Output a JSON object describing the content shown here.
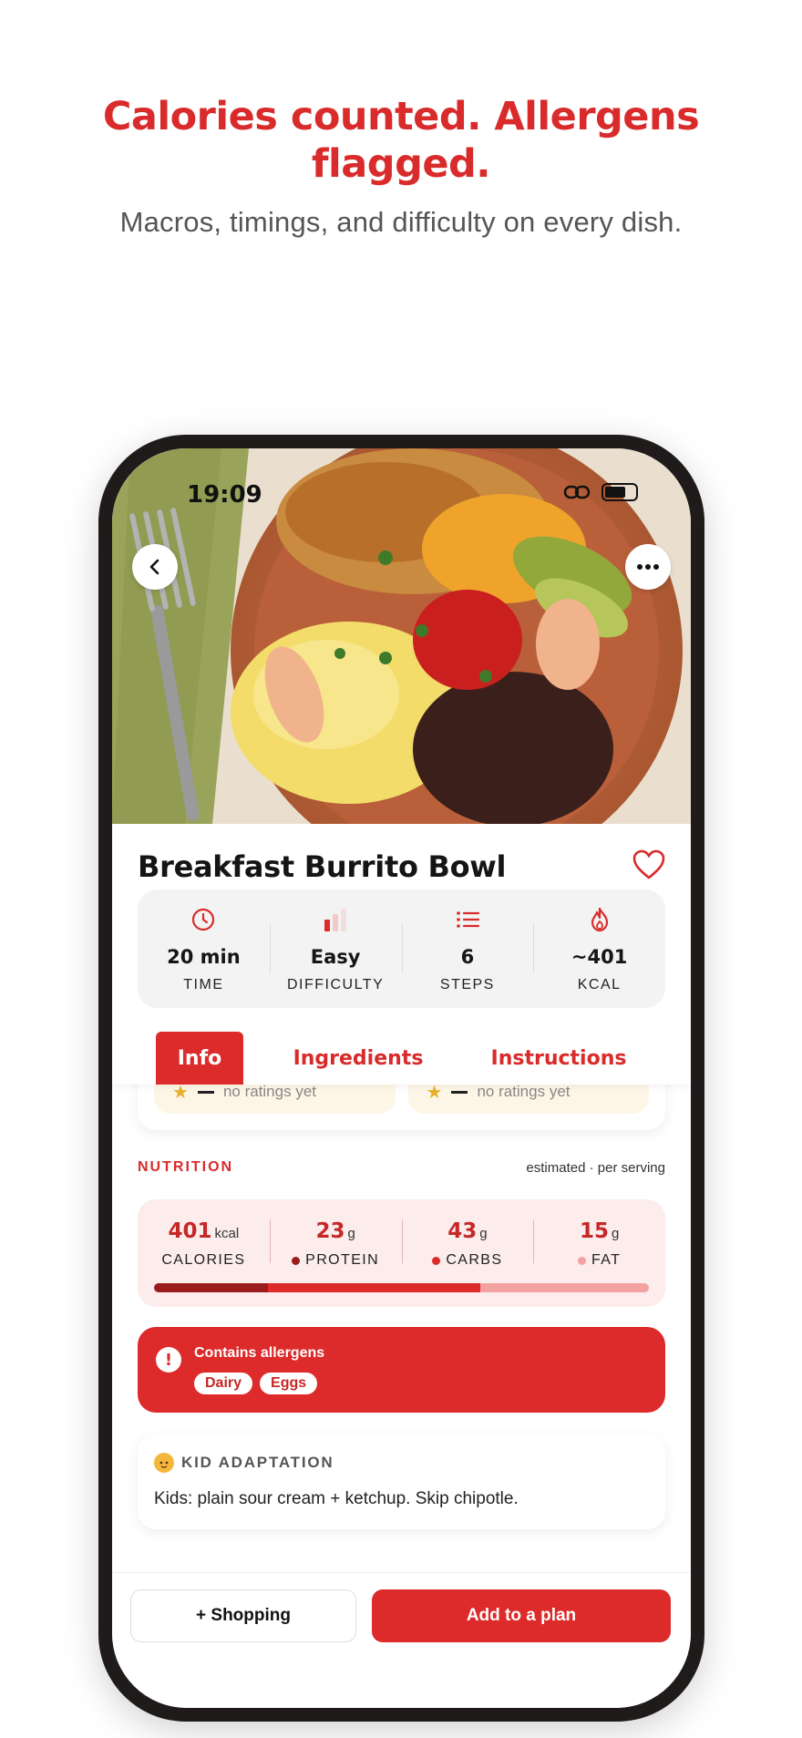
{
  "promo": {
    "headline": "Calories counted. Allergens flagged.",
    "subhead": "Macros, timings, and difficulty on every dish."
  },
  "status_bar": {
    "time": "19:09"
  },
  "recipe": {
    "title": "Breakfast Burrito Bowl",
    "stats": [
      {
        "icon": "clock-icon",
        "value": "20 min",
        "label": "TIME"
      },
      {
        "icon": "difficulty-bars-icon",
        "value": "Easy",
        "label": "DIFFICULTY"
      },
      {
        "icon": "list-icon",
        "value": "6",
        "label": "STEPS"
      },
      {
        "icon": "flame-icon",
        "value": "~401",
        "label": "KCAL"
      }
    ]
  },
  "tabs": [
    "Info",
    "Ingredients",
    "Instructions"
  ],
  "active_tab": "Info",
  "ratings": [
    {
      "text": "no ratings yet"
    },
    {
      "text": "no ratings yet"
    }
  ],
  "nutrition": {
    "title": "NUTRITION",
    "note": "estimated · per serving",
    "macros": [
      {
        "value": "401",
        "unit": "kcal",
        "label": "CALORIES",
        "dot": ""
      },
      {
        "value": "23",
        "unit": "g",
        "label": "PROTEIN",
        "dot": "#9b1c1c"
      },
      {
        "value": "43",
        "unit": "g",
        "label": "CARBS",
        "dot": "#dd2a2a"
      },
      {
        "value": "15",
        "unit": "g",
        "label": "FAT",
        "dot": "#f4a1a1"
      }
    ],
    "bar_fractions": [
      0.23,
      0.43,
      0.34
    ],
    "bar_colors": [
      "#9b1c1c",
      "#dd2a2a",
      "#f4a1a1"
    ]
  },
  "allergens": {
    "title": "Contains allergens",
    "items": [
      "Dairy",
      "Eggs"
    ]
  },
  "kid_adaptation": {
    "title": "KID ADAPTATION",
    "text": "Kids: plain sour cream + ketchup. Skip chipotle."
  },
  "actions": {
    "shopping": "+ Shopping",
    "plan": "Add to a plan"
  },
  "colors": {
    "accent": "#dd2a2a",
    "headline": "#d92b2b"
  }
}
